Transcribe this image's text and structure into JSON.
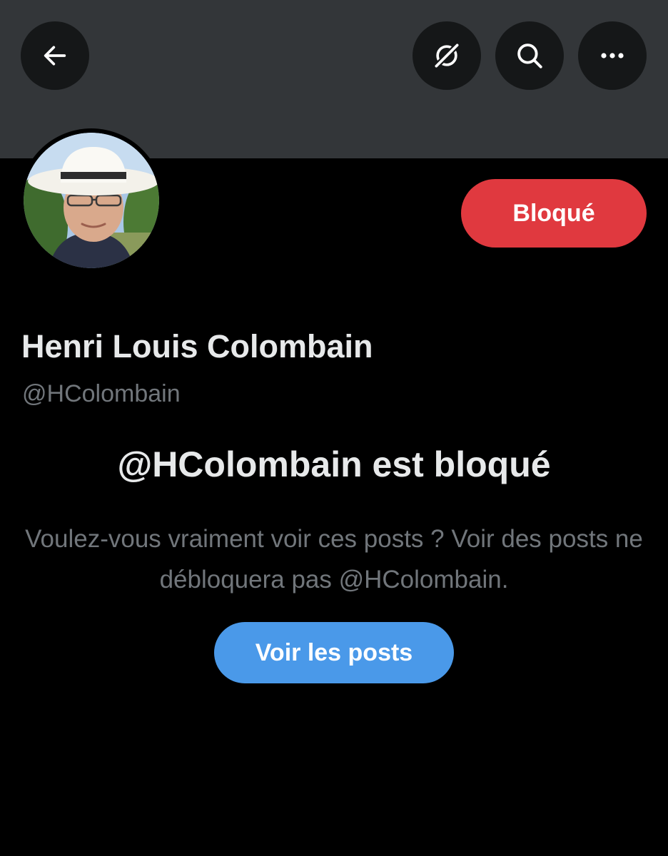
{
  "header": {
    "back_icon": "arrow-left-icon",
    "grok_icon": "grok-icon",
    "search_icon": "search-icon",
    "more_icon": "more-horizontal-icon"
  },
  "profile": {
    "display_name": "Henri Louis Colombain",
    "handle": "@HColombain",
    "blocked_button_label": "Bloqué"
  },
  "blocked_notice": {
    "title": "@HColombain est bloqué",
    "description": "Voulez-vous vraiment voir ces posts ? Voir des posts ne débloquera pas @HColombain.",
    "view_posts_label": "Voir les posts"
  },
  "colors": {
    "background": "#000000",
    "banner": "#333639",
    "blocked_button": "#e0393f",
    "view_posts_button": "#4a99e9",
    "secondary_text": "#71767b",
    "primary_text": "#e7e9ea"
  }
}
